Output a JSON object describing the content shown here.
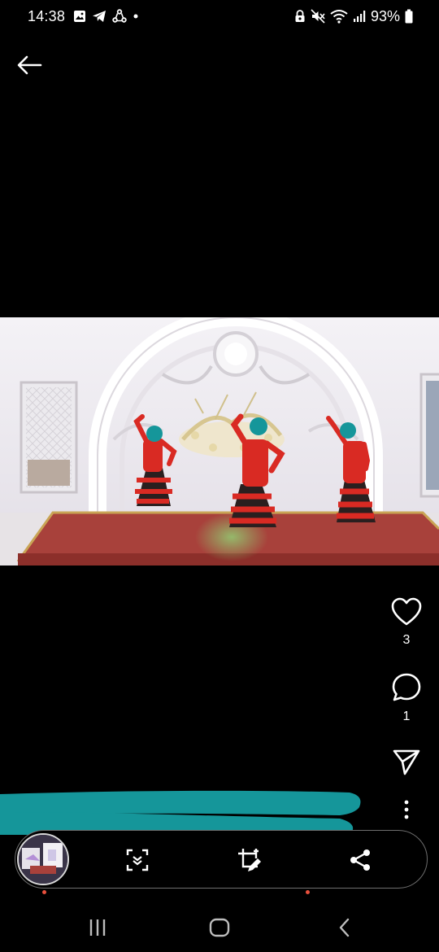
{
  "status_bar": {
    "time": "14:38",
    "battery": "93%",
    "left_icons": [
      "gallery-icon",
      "telegram-icon",
      "sync-icon",
      "dot-icon"
    ],
    "right_icons": [
      "lock-icon",
      "mute-icon",
      "wifi-icon",
      "signal-icon",
      "battery-icon"
    ]
  },
  "actions": {
    "like_count": "3",
    "comment_count": "1"
  },
  "colors": {
    "redaction": "#15969a",
    "stage_red": "#a8413b",
    "dress_red": "#d92a23",
    "accent_dot": "#e9503d"
  },
  "bottom_bar": {
    "icons": [
      "thumbnail",
      "scan-icon",
      "crop-edit-icon",
      "share-icon"
    ]
  },
  "nav_bar": {
    "icons": [
      "recent-apps-icon",
      "home-icon",
      "back-nav-icon"
    ]
  }
}
